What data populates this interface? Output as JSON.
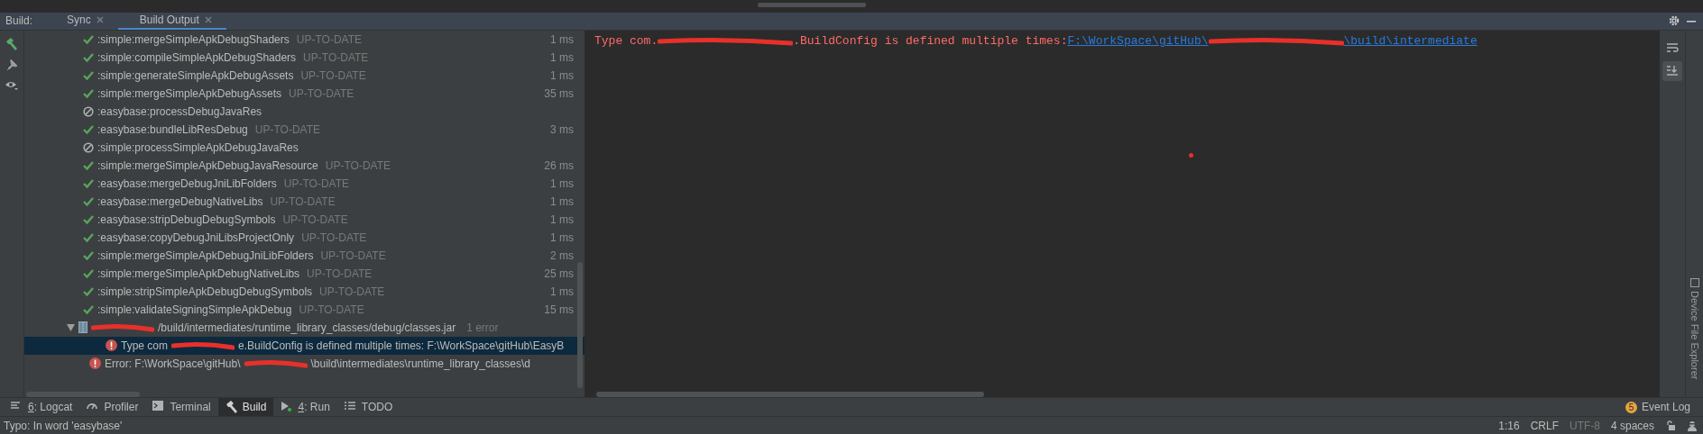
{
  "tab_bar": {
    "label": "Build:",
    "tabs": [
      {
        "label": "Sync",
        "selected": false
      },
      {
        "label": "Build Output",
        "selected": true
      }
    ]
  },
  "tree": {
    "rows": [
      {
        "kind": "done",
        "name": ":simple:mergeSimpleApkDebugShaders",
        "state": "UP-TO-DATE",
        "time": "1 ms"
      },
      {
        "kind": "done",
        "name": ":simple:compileSimpleApkDebugShaders",
        "state": "UP-TO-DATE",
        "time": "1 ms"
      },
      {
        "kind": "done",
        "name": ":simple:generateSimpleApkDebugAssets",
        "state": "UP-TO-DATE",
        "time": "1 ms"
      },
      {
        "kind": "done",
        "name": ":simple:mergeSimpleApkDebugAssets",
        "state": "UP-TO-DATE",
        "time": "35 ms"
      },
      {
        "kind": "skipped",
        "name": ":easybase:processDebugJavaRes"
      },
      {
        "kind": "done",
        "name": ":easybase:bundleLibResDebug",
        "state": "UP-TO-DATE",
        "time": "3 ms"
      },
      {
        "kind": "skipped",
        "name": ":simple:processSimpleApkDebugJavaRes"
      },
      {
        "kind": "done",
        "name": ":simple:mergeSimpleApkDebugJavaResource",
        "state": "UP-TO-DATE",
        "time": "26 ms"
      },
      {
        "kind": "done",
        "name": ":easybase:mergeDebugJniLibFolders",
        "state": "UP-TO-DATE",
        "time": "1 ms"
      },
      {
        "kind": "done",
        "name": ":easybase:mergeDebugNativeLibs",
        "state": "UP-TO-DATE",
        "time": "1 ms"
      },
      {
        "kind": "done",
        "name": ":easybase:stripDebugDebugSymbols",
        "state": "UP-TO-DATE",
        "time": "1 ms"
      },
      {
        "kind": "done",
        "name": ":easybase:copyDebugJniLibsProjectOnly",
        "state": "UP-TO-DATE",
        "time": "1 ms"
      },
      {
        "kind": "done",
        "name": ":simple:mergeSimpleApkDebugJniLibFolders",
        "state": "UP-TO-DATE",
        "time": "2 ms"
      },
      {
        "kind": "done",
        "name": ":simple:mergeSimpleApkDebugNativeLibs",
        "state": "UP-TO-DATE",
        "time": "25 ms"
      },
      {
        "kind": "done",
        "name": ":simple:stripSimpleApkDebugDebugSymbols",
        "state": "UP-TO-DATE",
        "time": "1 ms"
      },
      {
        "kind": "done",
        "name": ":simple:validateSigningSimpleApkDebug",
        "state": "UP-TO-DATE",
        "time": "15 ms"
      },
      {
        "kind": "file",
        "expanded": true,
        "segments": [
          {
            "kind": "redaction"
          },
          {
            "kind": "text",
            "text": "/build/intermediates/runtime_library_classes/debug/classes.jar"
          }
        ],
        "count": "1 error",
        "children": [
          {
            "kind": "error",
            "selected": true,
            "segments": [
              {
                "kind": "text",
                "text": "Type com"
              },
              {
                "kind": "redaction"
              },
              {
                "kind": "text",
                "text": "e.BuildConfig is defined multiple times: F:\\WorkSpace\\gitHub\\EasyB"
              }
            ]
          }
        ]
      },
      {
        "kind": "error",
        "selected": false,
        "segments": [
          {
            "kind": "text",
            "text": "Error: F:\\WorkSpace\\gitHub\\"
          },
          {
            "kind": "redaction"
          },
          {
            "kind": "text",
            "text": "\\build\\intermediates\\runtime_library_classes\\d"
          }
        ]
      }
    ]
  },
  "console": {
    "segments": [
      {
        "kind": "text",
        "text": "Type com."
      },
      {
        "kind": "redaction"
      },
      {
        "kind": "text",
        "text": ".BuildConfig is defined multiple times: "
      },
      {
        "kind": "link",
        "text": "F:\\WorkSpace\\gitHub\\"
      },
      {
        "kind": "redaction"
      },
      {
        "kind": "link",
        "text": "\\build\\intermediate"
      }
    ]
  },
  "side_panel": {
    "label": "Device File Explorer"
  },
  "tool_windows": [
    {
      "mnemonic": "6",
      "label": ": Logcat",
      "kind": "lines",
      "selected": false
    },
    {
      "label": "Profiler",
      "kind": "gauge",
      "selected": false
    },
    {
      "label": "Terminal",
      "kind": "terminal",
      "selected": false
    },
    {
      "label": "Build",
      "kind": "hammer",
      "selected": true
    },
    {
      "mnemonic": "4",
      "label": ": Run",
      "kind": "run",
      "selected": false
    },
    {
      "label": "TODO",
      "kind": "list",
      "selected": false
    }
  ],
  "event_log": {
    "count": "5",
    "label": "Event Log"
  },
  "status_bar": {
    "message": "Typo: In word 'easybase'",
    "position": "1:16",
    "line_separator": "CRLF",
    "encoding": "UTF-8",
    "indent": "4 spaces"
  }
}
